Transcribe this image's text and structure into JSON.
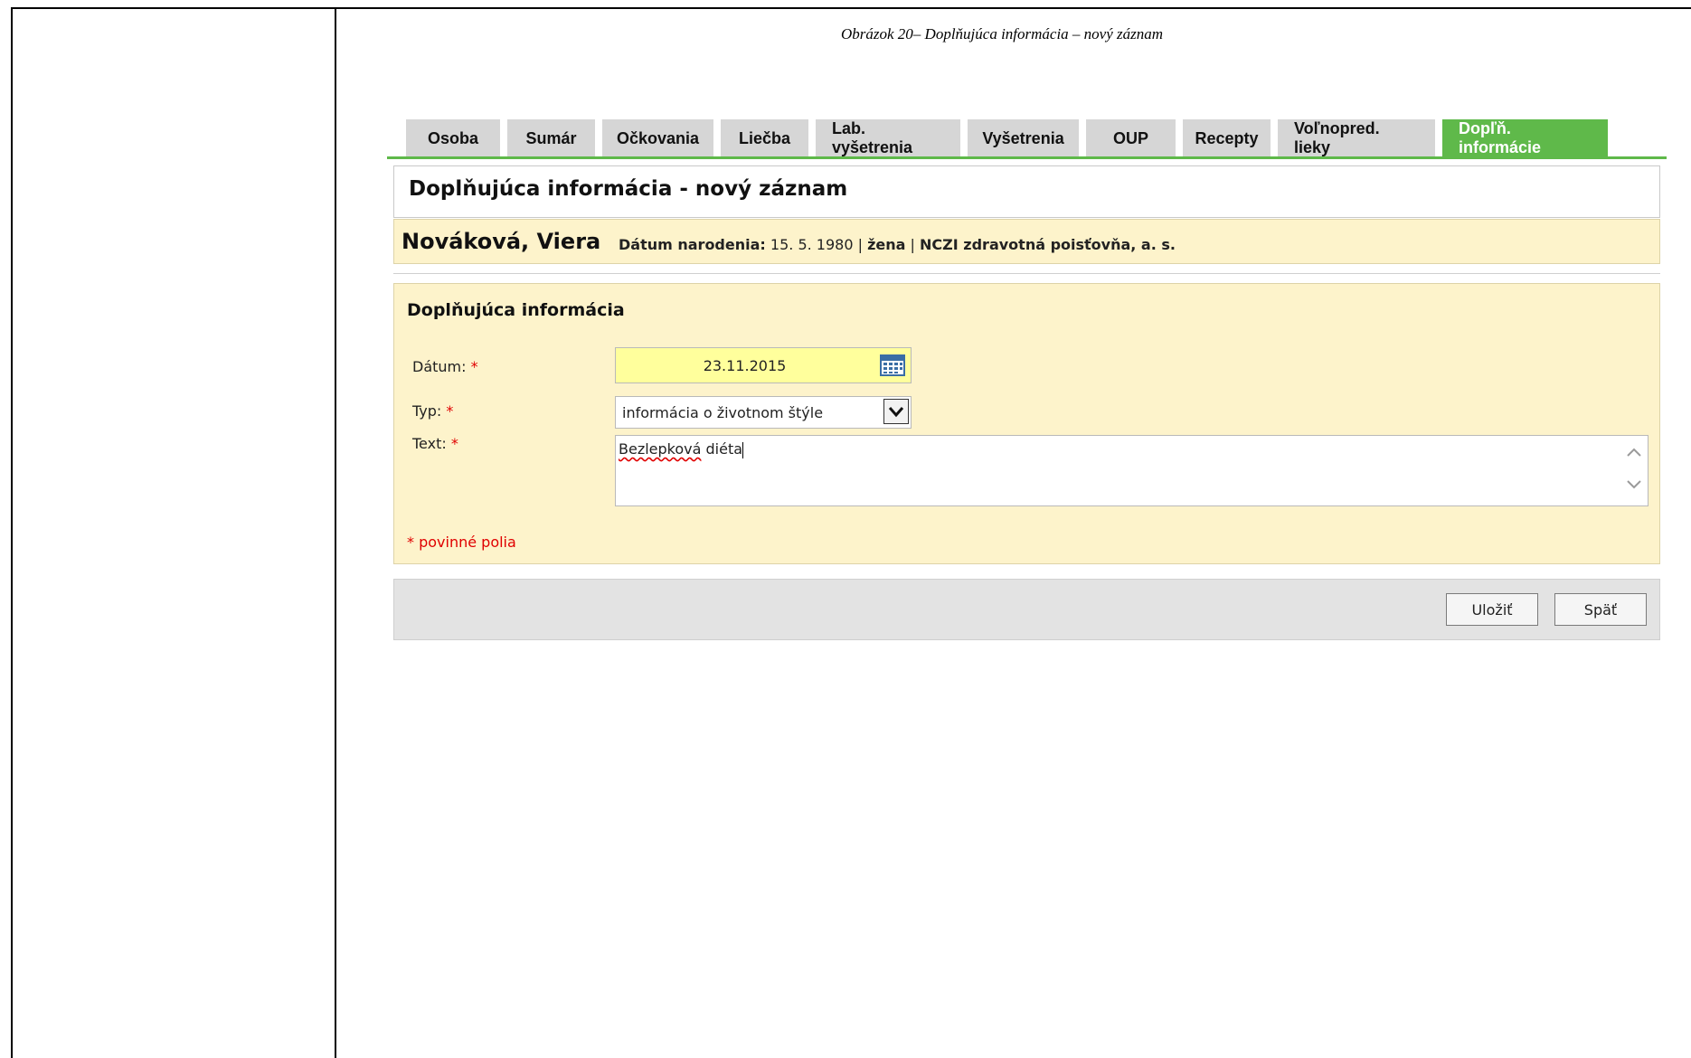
{
  "caption": "Obrázok 20– Doplňujúca informácia – nový záznam",
  "tabs": [
    {
      "label": "Osoba"
    },
    {
      "label": "Sumár"
    },
    {
      "label": "Očkovania"
    },
    {
      "label": "Liečba"
    },
    {
      "label": "Lab. vyšetrenia"
    },
    {
      "label": "Vyšetrenia"
    },
    {
      "label": "OUP"
    },
    {
      "label": "Recepty"
    },
    {
      "label": "Voľnopred. lieky"
    },
    {
      "label": "Dopľň. informácie",
      "active": true
    }
  ],
  "header": {
    "title": "Doplňujúca informácia - nový záznam"
  },
  "patient": {
    "name": "Nováková, Viera",
    "dob_label": "Dátum narodenia:",
    "dob_value": "15. 5. 1980",
    "separator": "|",
    "gender": "žena",
    "insurer": "NCZI zdravotná poisťovňa, a. s."
  },
  "form": {
    "title": "Doplňujúca informácia",
    "required_mark": "*",
    "date_label": "Dátum:",
    "date_value": "23.11.2015",
    "type_label": "Typ:",
    "type_value": "informácia o životnom štýle",
    "text_label": "Text:",
    "text_value_word1": "Bezlepková",
    "text_value_word2": "diéta",
    "required_note": "* povinné polia"
  },
  "actions": {
    "save": "Uložiť",
    "back": "Späť"
  },
  "colors": {
    "active_tab": "#5fb94a",
    "tab_bg": "#d6d6d6",
    "panel_bg": "#fdf3cb",
    "date_input_bg": "#ffff9c",
    "required": "#e00000"
  },
  "icons": {
    "date": "calendar-icon",
    "select": "chevron-down-icon",
    "scroll_up": "chevron-up-icon",
    "scroll_down": "chevron-down-icon"
  }
}
